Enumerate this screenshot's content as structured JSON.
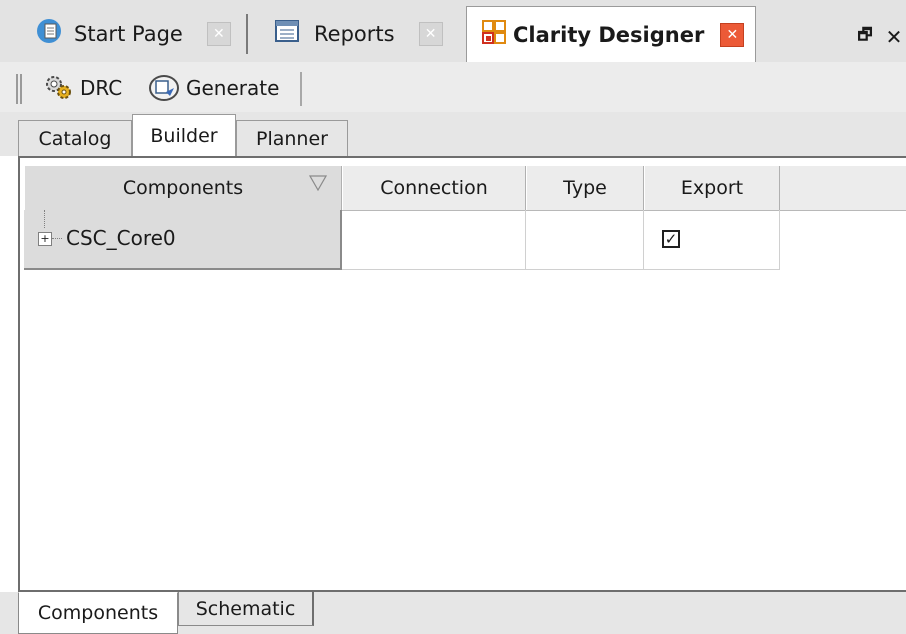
{
  "doc_tabs": [
    {
      "label": "Start Page",
      "icon": "start-page-icon"
    },
    {
      "label": "Reports",
      "icon": "reports-icon"
    },
    {
      "label": "Clarity Designer",
      "icon": "clarity-designer-icon",
      "active": true
    }
  ],
  "window_controls": {
    "restore": "restore-icon",
    "close": "close-icon"
  },
  "toolbar": {
    "drc_label": "DRC",
    "generate_label": "Generate"
  },
  "sub_tabs": {
    "catalog": "Catalog",
    "builder": "Builder",
    "planner": "Planner",
    "active": "Builder"
  },
  "table": {
    "columns": [
      "Components",
      "Connection",
      "Type",
      "Export"
    ],
    "rows": [
      {
        "component": "CSC_Core0",
        "connection": "",
        "type": "",
        "export": true
      }
    ]
  },
  "bottom_tabs": {
    "components": "Components",
    "schematic": "Schematic",
    "active": "Components"
  },
  "colors": {
    "close_active": "#ec5a37",
    "tab_bg": "#e3e3e3",
    "header_bg": "#ececec"
  }
}
